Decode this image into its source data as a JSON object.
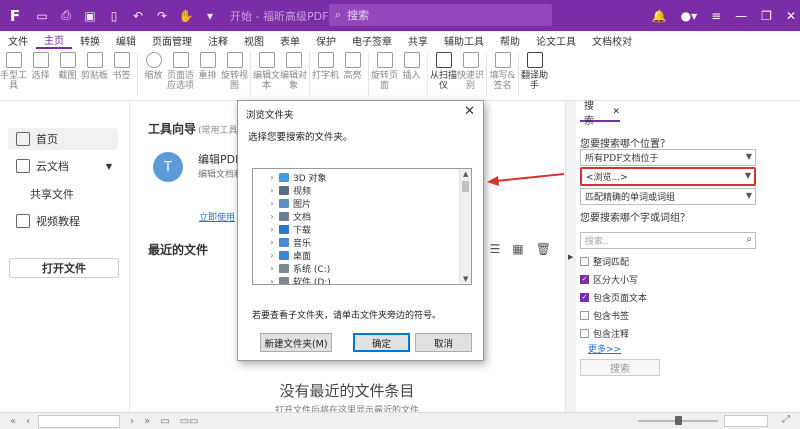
{
  "titlebar": {
    "logo": "F",
    "doc_title": "开始 - 福昕高级PDF编辑器",
    "search_placeholder": "搜索",
    "icons": [
      "open-icon",
      "print-icon",
      "save-icon",
      "undo-icon",
      "redo-icon",
      "hand-tool-icon",
      "bell-icon",
      "user-icon",
      "minimize-icon",
      "maximize-icon",
      "close-icon"
    ]
  },
  "menubar": {
    "items": [
      "文件",
      "主页",
      "转换",
      "编辑",
      "页面管理",
      "注释",
      "视图",
      "表单",
      "保护",
      "电子签章",
      "共享",
      "辅助工具",
      "帮助",
      "论文工具",
      "文档校对"
    ],
    "active": "主页"
  },
  "ribbon": {
    "buttons": [
      "手型工具",
      "选择",
      "截图",
      "剪贴板",
      "书签",
      "缩放",
      "页面适应选项",
      "重排",
      "旋转视图",
      "编辑文本",
      "编辑对象",
      "打字机",
      "高亮",
      "旋转页面",
      "插入",
      "从扫描仪",
      "快速识别",
      "填写&签名",
      "翻译助手"
    ]
  },
  "leftnav": {
    "items": [
      {
        "label": "首页",
        "icon": "home-icon"
      },
      {
        "label": "云文档",
        "icon": "cloud-icon"
      },
      {
        "label": "共享文件",
        "icon": "share-icon"
      },
      {
        "label": "视频教程",
        "icon": "video-icon"
      }
    ],
    "open_button": "打开文件"
  },
  "main": {
    "tools_title": "工具向导",
    "tools_sub": "(常用工具)",
    "tool_name": "编辑PDF",
    "tool_desc": "编辑文档和页面",
    "tool_link": "立即使用",
    "recent_title": "最近的文件",
    "empty_msg": "没有最近的文件条目",
    "empty_sub": "打开文件后将在这里显示最近的文件"
  },
  "dialog": {
    "title": "浏览文件夹",
    "prompt": "选择您要搜索的文件夹。",
    "tree": [
      {
        "label": "3D 对象",
        "color": "#3aa0e6"
      },
      {
        "label": "视频",
        "color": "#5c6e84"
      },
      {
        "label": "图片",
        "color": "#5c8fc7"
      },
      {
        "label": "文档",
        "color": "#6b7f99"
      },
      {
        "label": "下载",
        "color": "#2a78c9"
      },
      {
        "label": "音乐",
        "color": "#4d8ad0"
      },
      {
        "label": "桌面",
        "color": "#3d86d6"
      },
      {
        "label": "系统 (C:)",
        "color": "#7a8794"
      },
      {
        "label": "软件 (D:)",
        "color": "#7a8794"
      }
    ],
    "hint": "若要查看子文件夹，请单击文件夹旁边的符号。",
    "new_folder": "新建文件夹(M)",
    "ok": "确定",
    "cancel": "取消"
  },
  "search_panel": {
    "tab": "搜索",
    "q1": "您要搜索哪个位置？",
    "location": "所有PDF文档位于",
    "browse": "<浏览...>",
    "match": "匹配精确的单词或词组",
    "q2": "您要搜索哪个字或词组？",
    "input_placeholder": "搜索..",
    "options": [
      {
        "label": "整词匹配",
        "checked": false
      },
      {
        "label": "区分大小写",
        "checked": true
      },
      {
        "label": "包含页面文本",
        "checked": true
      },
      {
        "label": "包含书签",
        "checked": false
      },
      {
        "label": "包含注释",
        "checked": false
      }
    ],
    "more": "更多>>",
    "search_button": "搜索"
  },
  "colors": {
    "brand": "#7b2da7",
    "annotation": "#d8322d",
    "link": "#2b6fd6"
  }
}
